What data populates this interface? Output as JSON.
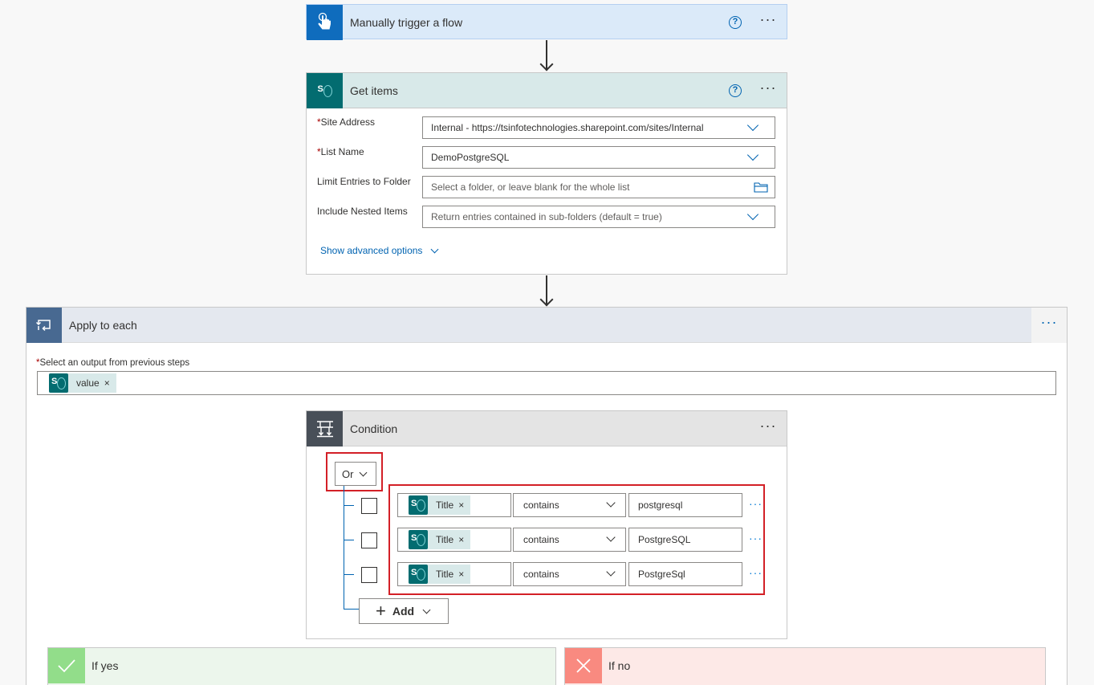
{
  "trigger": {
    "title": "Manually trigger a flow",
    "help_label": "?",
    "more_label": "···",
    "color": "#0f6cbd"
  },
  "get_items": {
    "title": "Get items",
    "help_label": "?",
    "more_label": "···",
    "fields": [
      {
        "label": "Site Address",
        "required": true,
        "value": "Internal - https://tsinfotechnologies.sharepoint.com/sites/Internal",
        "control": "dropdown"
      },
      {
        "label": "List Name",
        "required": true,
        "value": "DemoPostgreSQL",
        "control": "dropdown"
      },
      {
        "label": "Limit Entries to Folder",
        "required": false,
        "placeholder": "Select a folder, or leave blank for the whole list",
        "control": "folder"
      },
      {
        "label": "Include Nested Items",
        "required": false,
        "placeholder": "Return entries contained in sub-folders (default = true)",
        "control": "dropdown"
      }
    ],
    "advanced_link": "Show advanced options",
    "required_mark": "*"
  },
  "apply_to_each": {
    "title": "Apply to each",
    "more_label": "···",
    "output_label": "Select an output from previous steps",
    "required_mark": "*",
    "token": {
      "label": "value",
      "remove": "×"
    }
  },
  "condition": {
    "title": "Condition",
    "more_label": "···",
    "group_operator": "Or",
    "rows": [
      {
        "token": "Title",
        "remove": "×",
        "operator": "contains",
        "value": "postgresql"
      },
      {
        "token": "Title",
        "remove": "×",
        "operator": "contains",
        "value": "PostgreSQL"
      },
      {
        "token": "Title",
        "remove": "×",
        "operator": "contains",
        "value": "PostgreSql"
      }
    ],
    "row_more_label": "···",
    "add_label": "Add",
    "add_icon": "+"
  },
  "branches": {
    "yes_label": "If yes",
    "no_label": "If no",
    "yes_color": "#92dd8a",
    "no_color": "#f98a80"
  },
  "colors": {
    "highlight": "#d32027",
    "link": "#0063b1"
  }
}
